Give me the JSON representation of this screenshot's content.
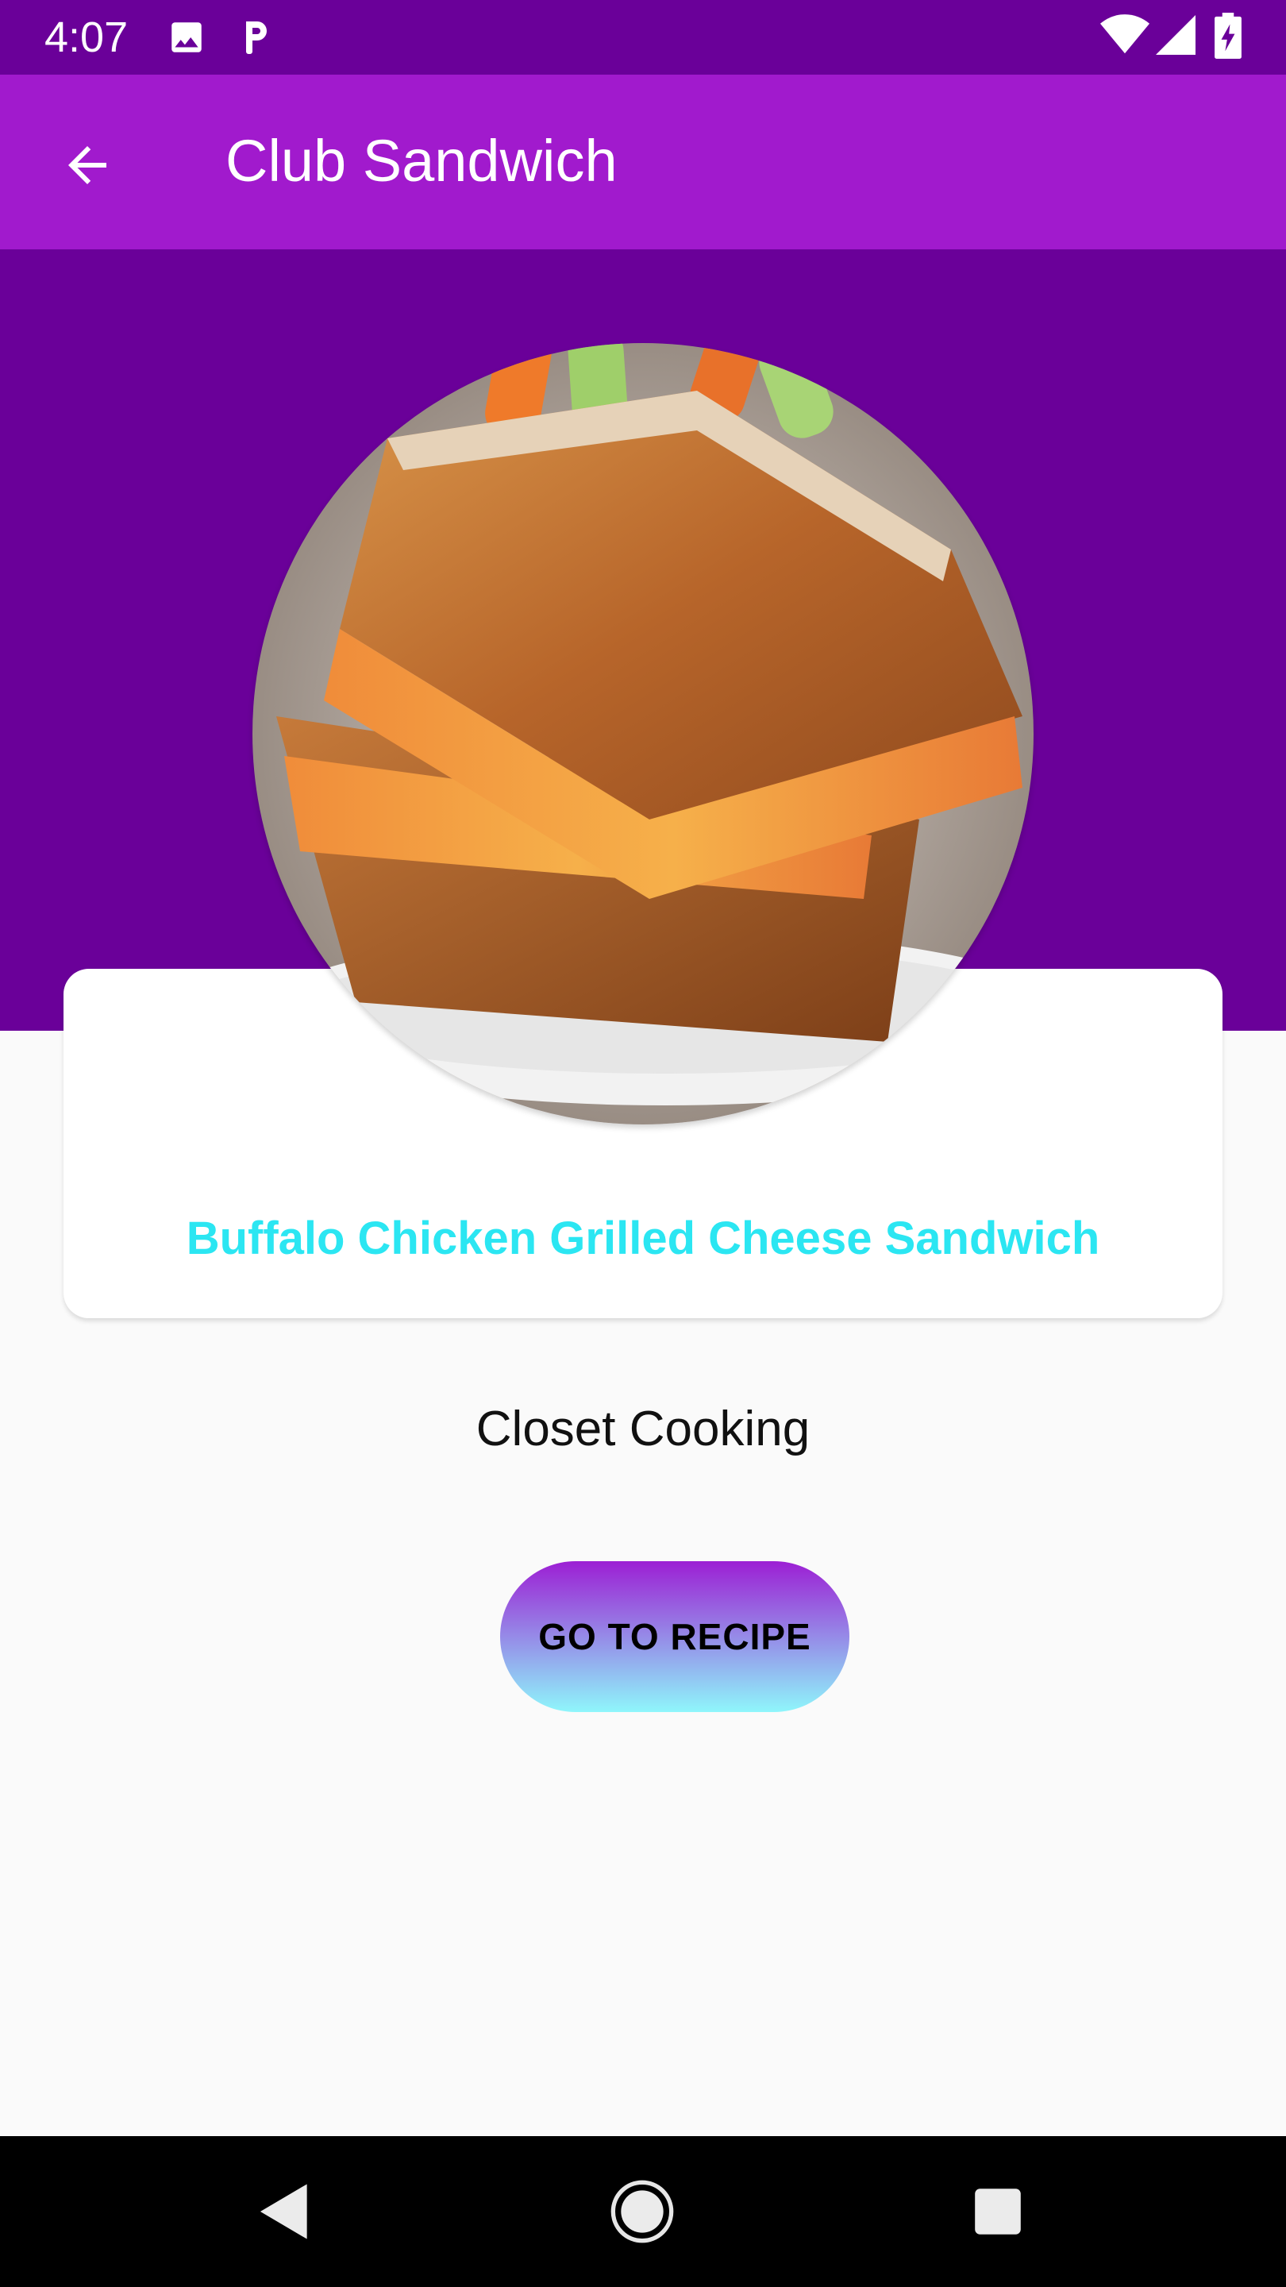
{
  "status_bar": {
    "time": "4:07",
    "left_icons": [
      "image-icon",
      "parking-p-icon"
    ],
    "right_icons": [
      "wifi-icon",
      "signal-icon",
      "battery-charging-icon"
    ]
  },
  "app_bar": {
    "title": "Club Sandwich",
    "back_icon": "arrow-back-icon"
  },
  "recipe": {
    "title": "Buffalo Chicken Grilled Cheese Sandwich",
    "source": "Closet Cooking",
    "button_label": "GO TO RECIPE"
  },
  "nav_bar": {
    "icons": [
      "nav-back-icon",
      "nav-home-icon",
      "nav-recents-icon"
    ]
  },
  "colors": {
    "status_bar": "#6a0099",
    "app_bar": "#a11acd",
    "hero": "#6a0099",
    "title_text": "#2be6f2",
    "button_gradient_top": "#9c1fd4",
    "button_gradient_bottom": "#8ff6fb",
    "background": "#fafafa"
  }
}
